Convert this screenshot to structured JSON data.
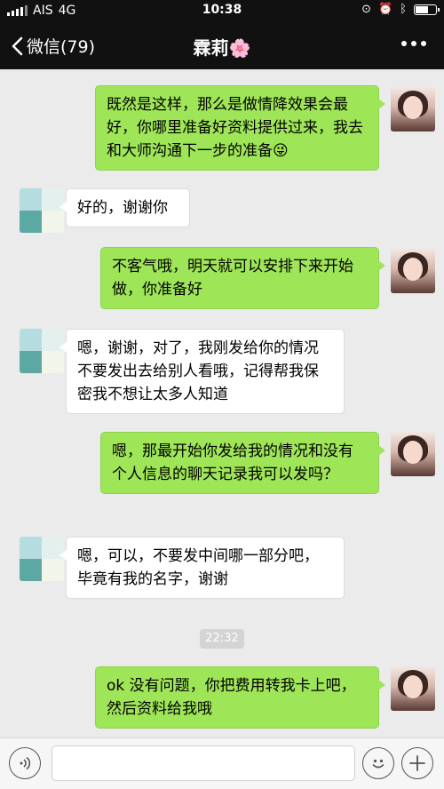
{
  "status": {
    "carrier": "AIS",
    "network": "4G",
    "time": "10:38"
  },
  "nav": {
    "back_label": "微信(79)",
    "title": "霖莉🌸"
  },
  "messages": [
    {
      "side": "right",
      "text": "既然是这样，那么是做情降效果会最好，你哪里准备好资料提供过来，我去和大师沟通下一步的准备😜"
    },
    {
      "side": "left",
      "text": "好的，谢谢你"
    },
    {
      "side": "right",
      "text": "不客气哦，明天就可以安排下来开始做，你准备好"
    },
    {
      "side": "left",
      "text": "嗯，谢谢，对了，我刚发给你的情况不要发出去给别人看哦，记得帮我保密我不想让太多人知道"
    },
    {
      "side": "right",
      "text": "嗯，那最开始你发给我的情况和没有个人信息的聊天记录我可以发吗？"
    },
    {
      "side": "left",
      "text": "嗯，可以，不要发中间哪一部分吧，毕竟有我的名字，谢谢"
    },
    {
      "side": "right",
      "text": "ok 没有问题，你把费用转我卡上吧，然后资料给我哦"
    }
  ],
  "time_separator": "22:32",
  "icons": {
    "back": "chevron-left-icon",
    "more": "more-dots-icon",
    "voice": "voice-icon",
    "emoji": "emoji-icon",
    "plus": "plus-icon",
    "alarm": "alarm-icon",
    "bluetooth": "bluetooth-icon",
    "lock": "orientation-lock-icon"
  },
  "colors": {
    "bar": "#111111",
    "chat_bg": "#ebebeb",
    "my_bubble": "#9fe558",
    "their_bubble": "#ffffff"
  }
}
